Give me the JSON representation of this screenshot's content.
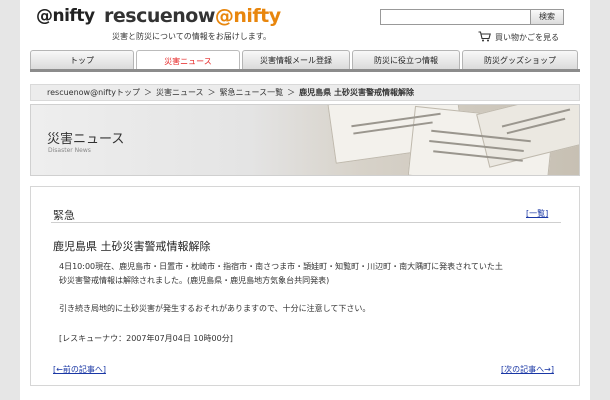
{
  "header": {
    "logo_nifty": "@nifty",
    "logo_rescue_main": "rescuenow",
    "logo_rescue_at": "@nifty",
    "tagline": "災害と防災についての情報をお届けします。",
    "search_placeholder": "",
    "search_button": "検索",
    "cart_label": "買い物かごを見る"
  },
  "nav": {
    "tabs": [
      {
        "label": "トップ"
      },
      {
        "label": "災害ニュース"
      },
      {
        "label": "災害情報メール登録"
      },
      {
        "label": "防災に役立つ情報"
      },
      {
        "label": "防災グッズショップ"
      }
    ]
  },
  "breadcrumb": {
    "items": [
      "rescuenow@niftyトップ",
      "災害ニュース",
      "緊急ニュース一覧"
    ],
    "separator": "＞",
    "current": "鹿児島県 土砂災害警戒情報解除"
  },
  "banner": {
    "title": "災害ニュース",
    "subtitle": "Disaster News"
  },
  "article": {
    "section": "緊急",
    "list_link": "[一覧]",
    "title": "鹿児島県 土砂災害警戒情報解除",
    "paragraph1_line1": "4日10:00現在、鹿児島市・日置市・枕崎市・指宿市・南さつま市・頴娃町・知覧町・川辺町・南大隅町に発表されていた土",
    "paragraph1_line2": "砂災害警戒情報は解除されました。(鹿児島県・鹿児島地方気象台共同発表)",
    "paragraph2": "引き続き局地的に土砂災害が発生するおそれがありますので、十分に注意して下さい。",
    "stamp": "[レスキューナウ：2007年07月04日 10時00分]",
    "prev_link": "[←前の記事へ]",
    "next_link": "[次の記事へ→]"
  },
  "colors": {
    "accent": "#e8860d",
    "active_tab": "#e52222",
    "link": "#1a37a5"
  }
}
